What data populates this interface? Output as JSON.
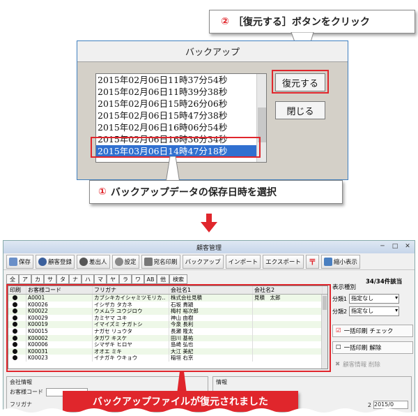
{
  "callouts": {
    "step2": {
      "num": "②",
      "text": "［復元する］ボタンをクリック"
    },
    "step1": {
      "num": "①",
      "text": "バックアップデータの保存日時を選択"
    },
    "result": "バックアップファイルが復元されました"
  },
  "dialog": {
    "title": "バックアップ",
    "items": [
      "2015年02月06日11時37分54秒",
      "2015年02月06日11時39分38秒",
      "2015年02月06日15時26分06秒",
      "2015年02月06日15時47分38秒",
      "2015年02月06日16時06分54秒",
      "2015年02月06日16時36分34秒",
      "2015年03月06日14時47分18秒"
    ],
    "restore_label": "復元する",
    "close_label": "閉じる"
  },
  "app": {
    "title": "顧客管理",
    "toolbar": [
      "保存",
      "顧客登録",
      "差出人",
      "設定",
      "宛名印刷",
      "バックアップ",
      "インポート",
      "エクスポート",
      "〒",
      "縮小表示"
    ],
    "tabs": [
      "全",
      "ア",
      "カ",
      "サ",
      "タ",
      "ナ",
      "ハ",
      "マ",
      "ヤ",
      "ラ",
      "ワ",
      "AB",
      "他",
      "検索"
    ],
    "count": "34/34件該当",
    "columns": [
      "印刷",
      "お客様コード",
      "フリガナ",
      "会社名1",
      "会社名2"
    ],
    "rows": [
      [
        "A0001",
        "カブシキカイシャミツモリカ..",
        "株式会社見積",
        "見積　太郎"
      ],
      [
        "K00026",
        "イシザカ タカネ",
        "石坂 貴頴",
        ""
      ],
      [
        "K00022",
        "ウメムラ ユウジロウ",
        "梅村 裕次郎",
        ""
      ],
      [
        "K00029",
        "カミヤマ ユキ",
        "神山 由樹",
        ""
      ],
      [
        "K00019",
        "イマイズミ ナガトシ",
        "今泉 長利",
        ""
      ],
      [
        "K00015",
        "ナガセ リュウタ",
        "長瀬 隆太",
        ""
      ],
      [
        "K00002",
        "タガワ キスケ",
        "田川 基祐",
        ""
      ],
      [
        "K00006",
        "シマザキ ヒロヤ",
        "島崎 弘也",
        ""
      ],
      [
        "K00031",
        "オオエ ミキ",
        "大江 美紀",
        ""
      ],
      [
        "K00023",
        "イナガキ ウキョウ",
        "稲垣 右京",
        ""
      ]
    ],
    "display_type": "表示種別",
    "cat1_label": "分類1",
    "cat1_value": "指定なし",
    "cat2_label": "分類2",
    "cat2_value": "指定なし",
    "bulk_check": "一括印刷 チェック",
    "bulk_clear": "一括印刷 解除",
    "delete_label": "顧客情報 削除",
    "company_info": "会社情報",
    "customer_code": "お客様コード",
    "info": "情報",
    "furigana": "フリガナ",
    "date_fragment": "2015/0",
    "suffix": "2"
  },
  "colors": {
    "accent_red": "#e0262c",
    "selection": "#3070d0"
  }
}
